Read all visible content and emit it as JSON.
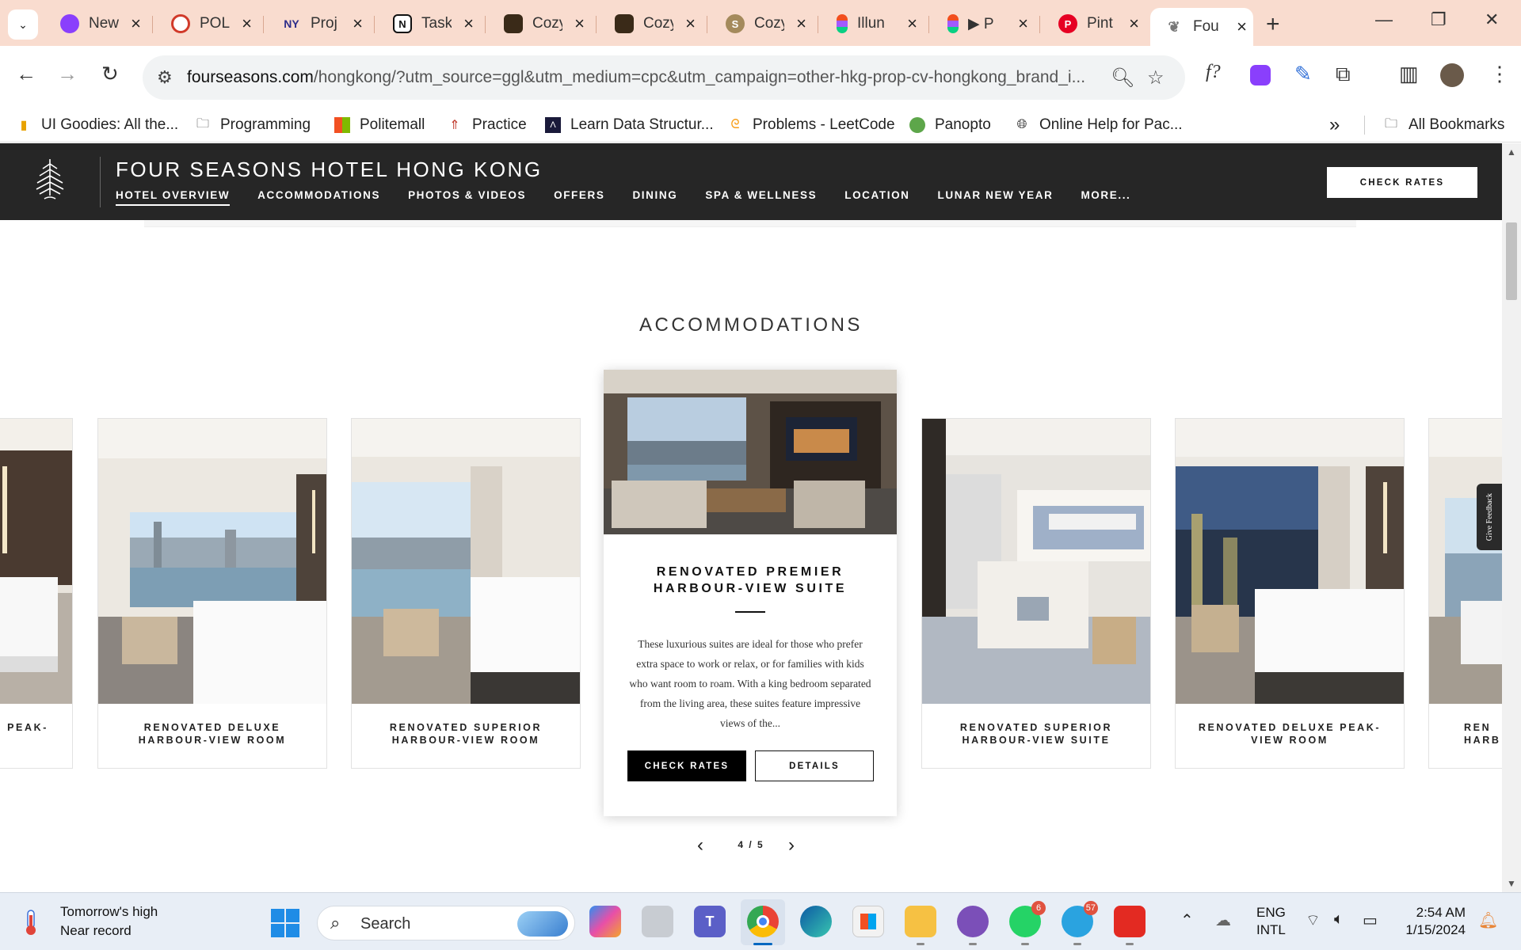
{
  "browser": {
    "tabs": [
      {
        "title": "New",
        "icon": "copilot-icon",
        "color": "#8a3ffc"
      },
      {
        "title": "POL",
        "icon": "pol-icon",
        "color": "#d13a2a"
      },
      {
        "title": "Proj",
        "icon": "nyp-icon",
        "color": "#2d2d8a"
      },
      {
        "title": "Task",
        "icon": "notion-icon",
        "color": "#111111"
      },
      {
        "title": "Cozy",
        "icon": "cozy-icon",
        "color": "#3a2a18"
      },
      {
        "title": "Cozy",
        "icon": "cozy-icon",
        "color": "#3a2a18"
      },
      {
        "title": "Cozy",
        "icon": "cozy-s-icon",
        "color": "#a48a5c"
      },
      {
        "title": "Illun",
        "icon": "figma-icon",
        "color": "#f24e1e"
      },
      {
        "title": "▶ P",
        "icon": "figma-icon",
        "color": "#f24e1e"
      },
      {
        "title": "Pint",
        "icon": "pinterest-icon",
        "color": "#e60023"
      },
      {
        "title": "Fou",
        "icon": "fourseasons-tab-icon",
        "color": "#888888",
        "active": true
      }
    ],
    "url_domain": "fourseasons.com",
    "url_rest": "/hongkong/?utm_source=ggl&utm_medium=cpc&utm_campaign=other-hkg-prop-cv-hongkong_brand_i...",
    "ext_fx": "f?"
  },
  "bookmarks": {
    "items": [
      "UI Goodies: All the...",
      "Programming",
      "Politemall",
      "Practice",
      "Learn Data Structur...",
      "Problems - LeetCode",
      "Panopto",
      "Online Help for Pac..."
    ],
    "more": "»",
    "all": "All Bookmarks"
  },
  "site": {
    "hotel_name": "FOUR SEASONS HOTEL HONG KONG",
    "nav": [
      "HOTEL OVERVIEW",
      "ACCOMMODATIONS",
      "PHOTOS & VIDEOS",
      "OFFERS",
      "DINING",
      "SPA & WELLNESS",
      "LOCATION",
      "LUNAR NEW YEAR",
      "MORE..."
    ],
    "check_rates": "CHECK RATES"
  },
  "accommodations": {
    "title": "ACCOMMODATIONS",
    "cards": [
      {
        "line1": "E PEAK-",
        "line2": ""
      },
      {
        "line1": "RENOVATED DELUXE",
        "line2": "HARBOUR-VIEW ROOM"
      },
      {
        "line1": "RENOVATED SUPERIOR",
        "line2": "HARBOUR-VIEW ROOM"
      },
      {
        "line1": "RENOVATED SUPERIOR",
        "line2": "HARBOUR-VIEW SUITE"
      },
      {
        "line1": "RENOVATED DELUXE PEAK-",
        "line2": "VIEW ROOM"
      },
      {
        "line1": "REN",
        "line2": "HARB"
      }
    ],
    "featured": {
      "line1": "RENOVATED PREMIER",
      "line2": "HARBOUR-VIEW SUITE",
      "description": "These luxurious suites are ideal for those who prefer extra space to work or relax, or for families with kids who want room to roam. With a king bedroom separated from the living area, these suites feature impressive views of the...",
      "check_rates": "CHECK RATES",
      "details": "DETAILS"
    },
    "pager": "4 / 5",
    "feedback": "Give Feedback"
  },
  "taskbar": {
    "weather_line1": "Tomorrow's high",
    "weather_line2": "Near record",
    "search": "Search",
    "whatsapp_badge": "6",
    "telegram_badge": "57",
    "lang_line1": "ENG",
    "lang_line2": "INTL",
    "time": "2:54 AM",
    "date": "1/15/2024"
  }
}
